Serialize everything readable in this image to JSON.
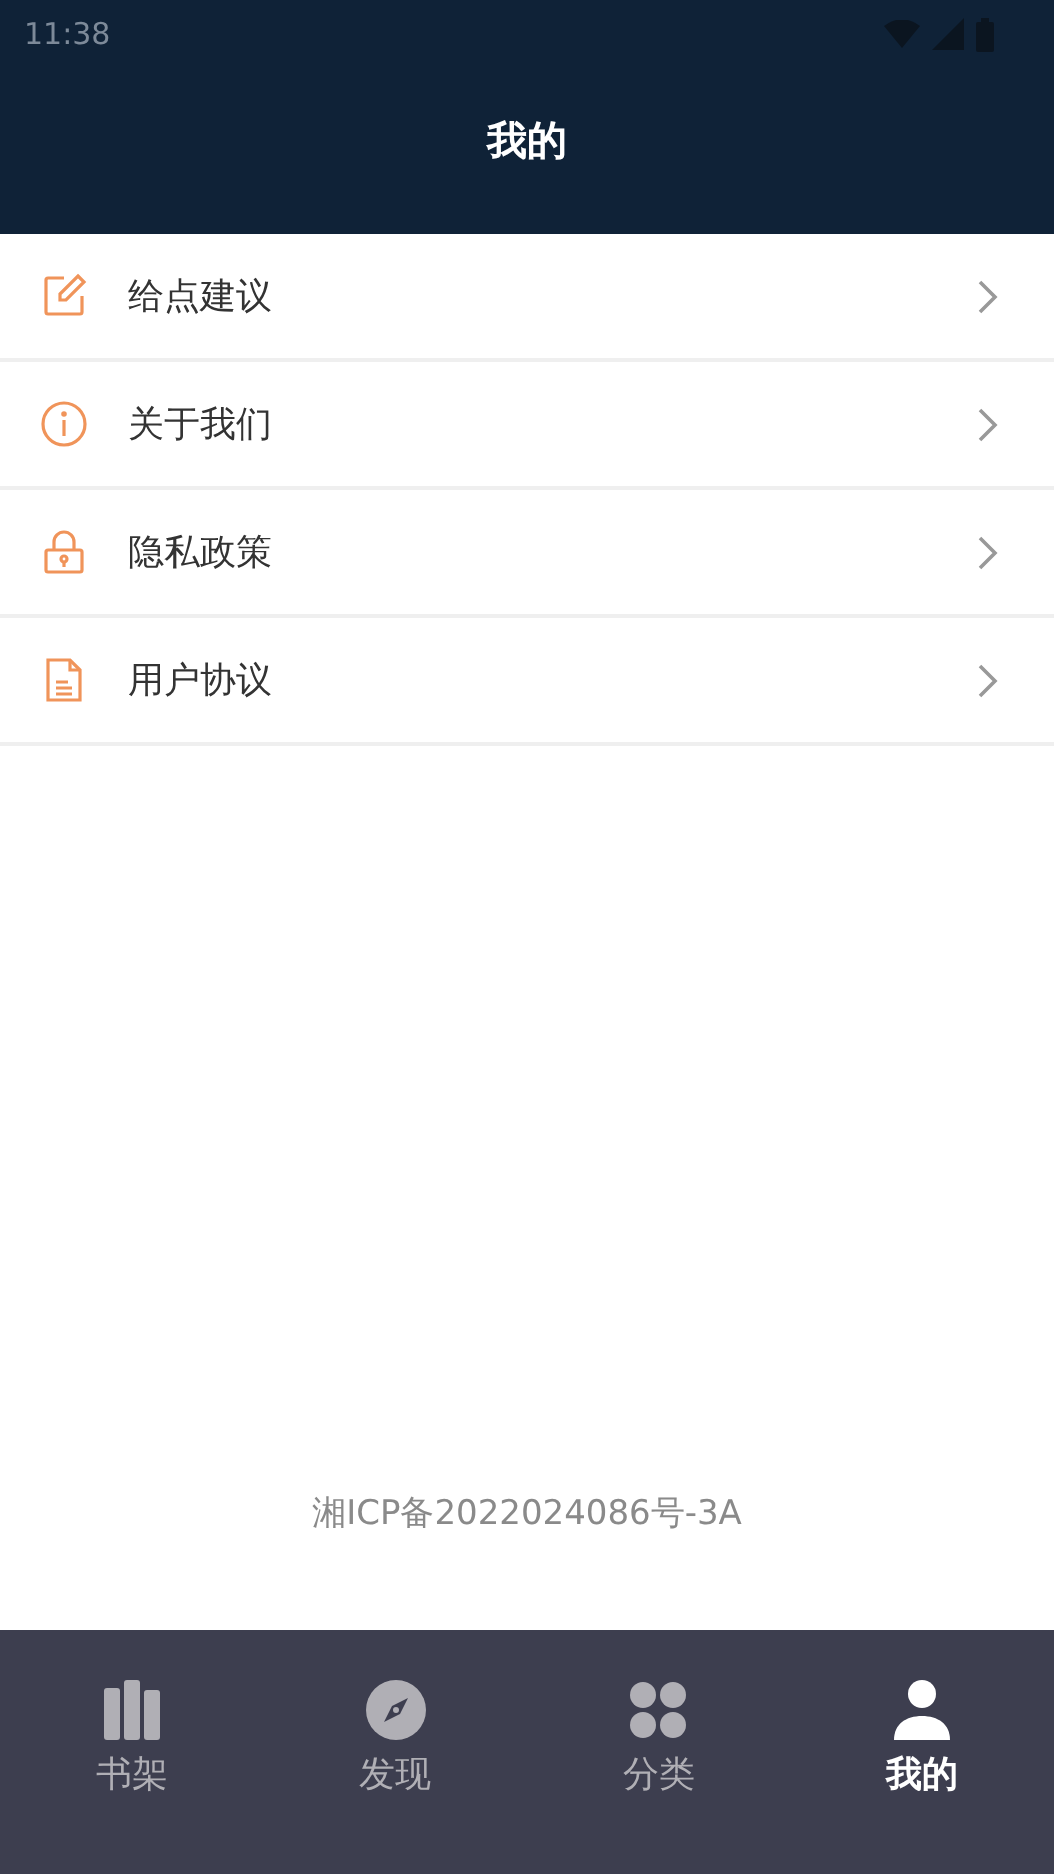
{
  "status_bar": {
    "time": "11:38"
  },
  "header": {
    "title": "我的"
  },
  "menu": [
    {
      "kind": "edit",
      "label": "给点建议"
    },
    {
      "kind": "info",
      "label": "关于我们"
    },
    {
      "kind": "lock",
      "label": "隐私政策"
    },
    {
      "kind": "document",
      "label": "用户协议"
    }
  ],
  "footer": {
    "license": "湘ICP备2022024086号-3A"
  },
  "tabs": [
    {
      "kind": "books",
      "label": "书架",
      "selected": false
    },
    {
      "kind": "compass",
      "label": "发现",
      "selected": false
    },
    {
      "kind": "grid",
      "label": "分类",
      "selected": false
    },
    {
      "kind": "person",
      "label": "我的",
      "selected": true
    }
  ]
}
